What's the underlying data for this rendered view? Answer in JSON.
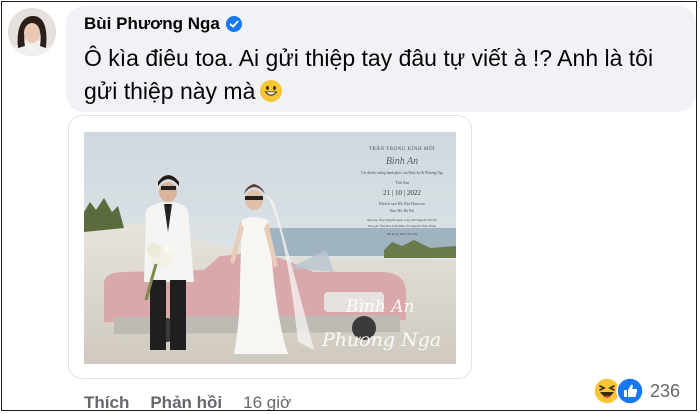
{
  "comment": {
    "author": "Bùi Phương Nga",
    "text": "Ô kìa điêu toa. Ai gửi thiệp tay đâu tự viết à !? Anh là tôi gửi thiệp này mà"
  },
  "attachment": {
    "invite_header": "TRÂN TRỌNG KÍNH MỜI",
    "invite_script": "Bình An",
    "invite_line": "Tới dự tiệc mừng hạnh phúc của Bình An & Phương Nga",
    "invite_time": "Thứ Sáu",
    "invite_date": "21 | 10 | 2022",
    "invite_venue": "Khách sạn Hà Nội Daewoo",
    "invite_address": "Kim Mã, Hà Nội",
    "invite_parents_1": "Nhà trai: Ông Nguyễn Quốc Long, Bà Nguyễn Thị Mỹ",
    "invite_parents_2": "Nhà gái: Ông Bùi Xuân Hữu, Bà Nguyễn Thúy Hằng",
    "invite_footer": "Rất mong được đón tiếp",
    "signature_1": "Bình An",
    "signature_2": "Phương Nga"
  },
  "actions": {
    "like": "Thích",
    "reply": "Phản hồi",
    "time": "16 giờ"
  },
  "reactions": {
    "count": "236",
    "types": [
      "haha-icon",
      "like-icon"
    ]
  },
  "colors": {
    "bubble": "#f0f2f5",
    "verified": "#1877f2",
    "meta_text": "#65676b",
    "car_pink": "#d9a8ab"
  }
}
